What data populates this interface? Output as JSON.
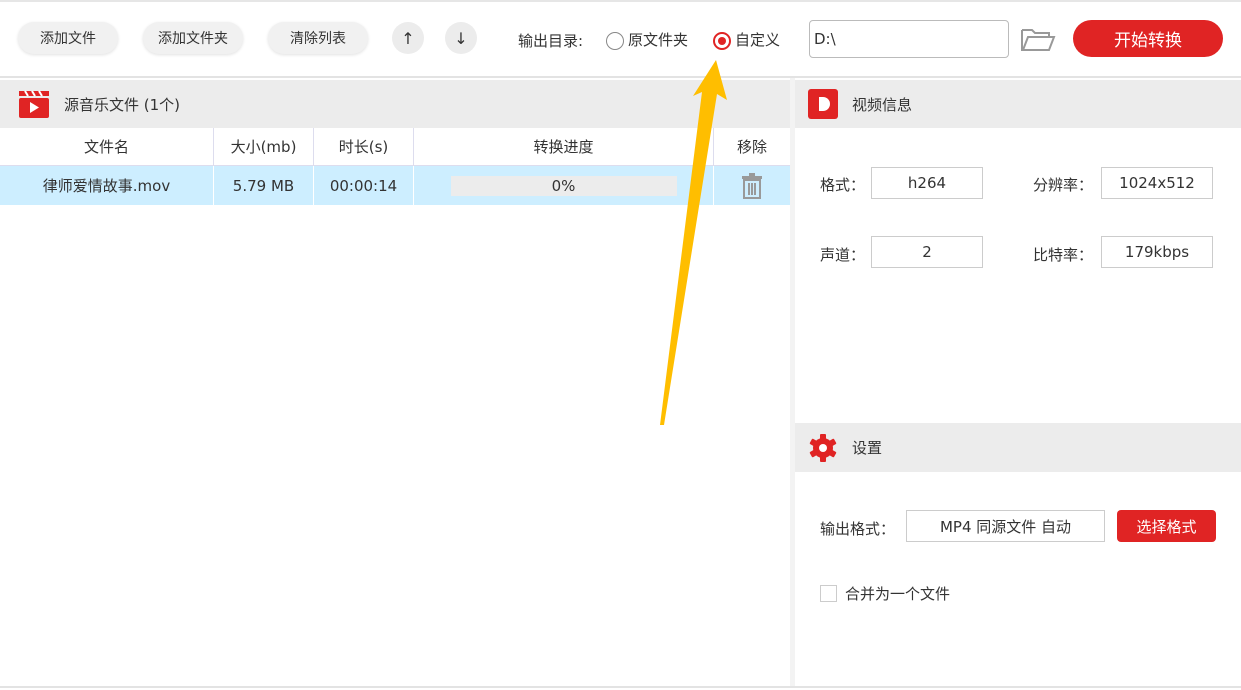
{
  "toolbar": {
    "add_file": "添加文件",
    "add_folder": "添加文件夹",
    "clear_list": "清除列表",
    "up": "↑",
    "down": "↓",
    "output_label": "输出目录:",
    "radio_original": "原文件夹",
    "radio_custom": "自定义",
    "output_path": "D:\\",
    "start": "开始转换"
  },
  "files": {
    "title": "源音乐文件 (1个)",
    "columns": [
      "文件名",
      "大小(mb)",
      "时长(s)",
      "转换进度",
      "移除"
    ],
    "rows": [
      {
        "name": "律师爱情故事.mov",
        "size": "5.79 MB",
        "duration": "00:00:14",
        "progress_text": "0%",
        "progress": 0
      }
    ]
  },
  "video_info": {
    "title": "视频信息",
    "format_label": "格式：",
    "format": "h264",
    "resolution_label": "分辨率：",
    "resolution": "1024x512",
    "channel_label": "声道：",
    "channel": "2",
    "bitrate_label": "比特率：",
    "bitrate": "179kbps"
  },
  "settings": {
    "title": "设置",
    "output_format_label": "输出格式：",
    "output_format": "MP4 同源文件 自动",
    "choose_format": "选择格式",
    "merge_label": "合并为一个文件",
    "merge_checked": false
  },
  "colors": {
    "accent": "#e02424",
    "row_selected": "#cdeeff",
    "arrow": "#ffbe00"
  }
}
